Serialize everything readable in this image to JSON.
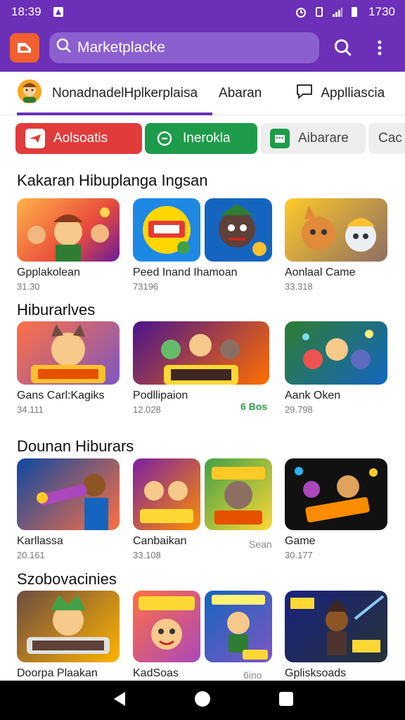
{
  "status_bar": {
    "time": "18:39",
    "battery": "1730"
  },
  "app_bar": {
    "search_value": "Marketplacke",
    "search_placeholder": "Marketplacke"
  },
  "tabs": [
    {
      "label": "NonadnadelHplkerplaisa"
    },
    {
      "label": "Abaran"
    },
    {
      "label": "Applliascia"
    }
  ],
  "chips": [
    {
      "label": "Aolsoatis",
      "color": "#e23b3b"
    },
    {
      "label": "Inerokla",
      "color": "#1e9b4a"
    },
    {
      "label": "Aibarare",
      "color": "#eeeeee"
    },
    {
      "label": "Cac",
      "color": "#eeeeee"
    }
  ],
  "sections": [
    {
      "title": "Kakaran Hibuplanga Ingsan",
      "items": [
        {
          "name": "Gpplakolean",
          "meta": "31.30",
          "icon": "game-art-icon"
        },
        {
          "name": "Peed Inand Ihamoan",
          "meta": "73196",
          "icon": "game-art-icon"
        },
        {
          "name": "Aonlaal Came",
          "meta": "33.318",
          "icon": "game-art-icon"
        }
      ]
    },
    {
      "title": "Hiburarlves",
      "items": [
        {
          "name": "Gans Carl:Kagiks",
          "meta": "34.111",
          "icon": "game-art-icon"
        },
        {
          "name": "Podllipaion",
          "meta": "12.028",
          "icon": "game-art-icon",
          "tag": "6 Bos"
        },
        {
          "name": "Aank Oken",
          "meta": "29.798",
          "icon": "game-art-icon"
        }
      ]
    },
    {
      "title": "Dounan Hiburars",
      "items": [
        {
          "name": "Karllassa",
          "meta": "20.161",
          "icon": "game-art-icon"
        },
        {
          "name": "Canbaikan",
          "meta": "33.108",
          "icon": "game-art-icon",
          "tag": "Sean"
        },
        {
          "name": "Game",
          "meta": "30.177",
          "icon": "game-art-icon"
        }
      ]
    },
    {
      "title": "Szobovacinies",
      "items": [
        {
          "name": "Doorpa Plaakan",
          "meta": "",
          "icon": "game-art-icon"
        },
        {
          "name": "KadSoas",
          "meta": "",
          "icon": "game-art-icon",
          "tag": "6ino"
        },
        {
          "name": "Gplisksoads",
          "meta": "",
          "icon": "game-art-icon"
        }
      ]
    }
  ],
  "colors": {
    "primary": "#6c2fb8",
    "search_bg": "#8c5fd0",
    "logo": "#f06030"
  }
}
